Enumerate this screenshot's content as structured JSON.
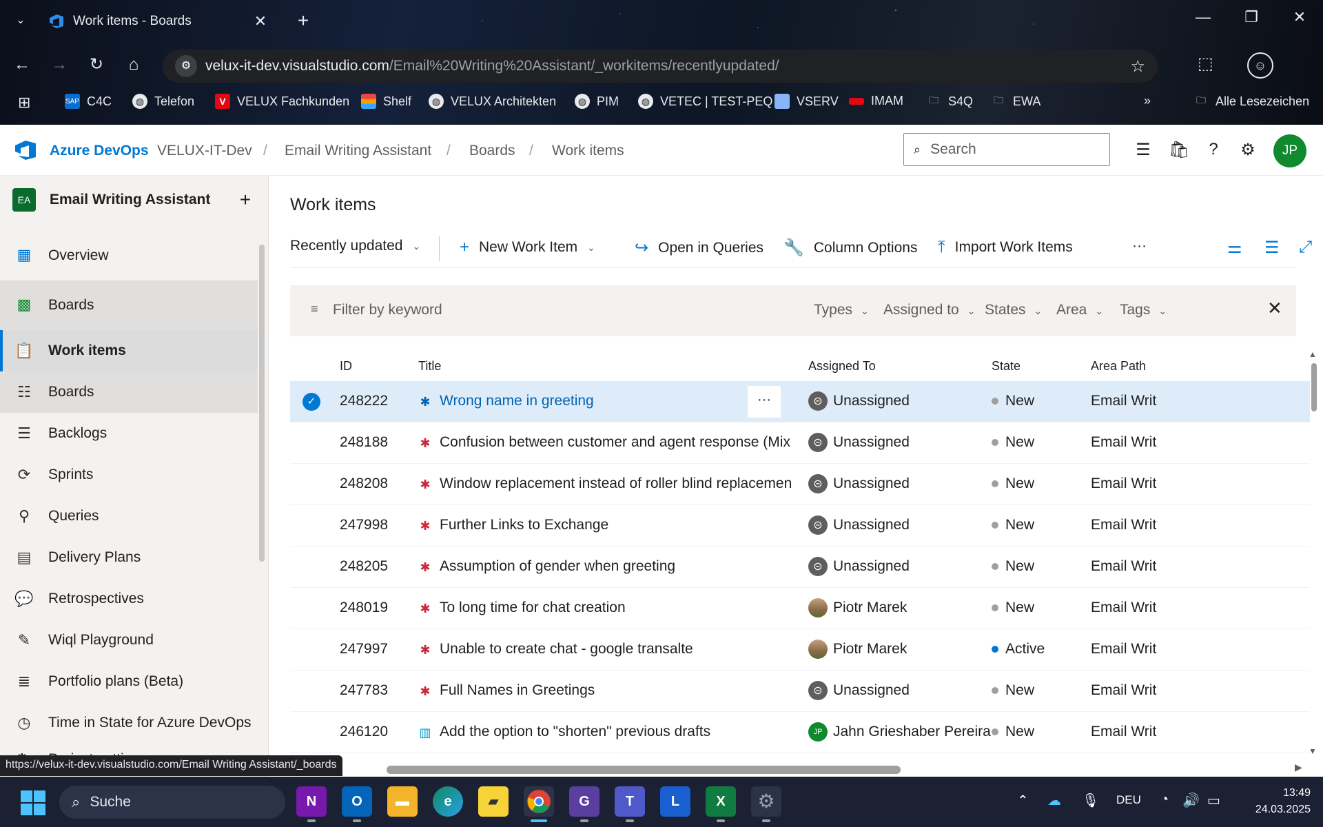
{
  "browser": {
    "tab_title": "Work items - Boards",
    "url_host": "velux-it-dev.visualstudio.com",
    "url_path": "/Email%20Writing%20Assistant/_workitems/recentlyupdated/",
    "bookmarks": [
      "C4C",
      "Telefon",
      "VELUX Fachkunden",
      "Shelf",
      "VELUX Architekten",
      "PIM",
      "VETEC | TEST-PEQ",
      "VSERV",
      "IMAM",
      "S4Q",
      "EWA"
    ],
    "all_bookmarks": "Alle Lesezeichen",
    "status_url": "https://velux-it-dev.visualstudio.com/Email Writing Assistant/_boards"
  },
  "header": {
    "brand": "Azure DevOps",
    "crumbs": [
      "VELUX-IT-Dev",
      "Email Writing Assistant",
      "Boards",
      "Work items"
    ],
    "search_placeholder": "Search",
    "avatar": "JP"
  },
  "sidebar": {
    "project_badge": "EA",
    "project_name": "Email Writing Assistant",
    "items": [
      {
        "label": "Overview"
      },
      {
        "label": "Boards"
      },
      {
        "label": "Work items"
      },
      {
        "label": "Boards"
      },
      {
        "label": "Backlogs"
      },
      {
        "label": "Sprints"
      },
      {
        "label": "Queries"
      },
      {
        "label": "Delivery Plans"
      },
      {
        "label": "Retrospectives"
      },
      {
        "label": "Wiql Playground"
      },
      {
        "label": "Portfolio plans (Beta)"
      },
      {
        "label": "Time in State for Azure DevOps"
      }
    ],
    "project_settings": "Project settings"
  },
  "main": {
    "title": "Work items",
    "view": "Recently updated",
    "commands": {
      "new_work_item": "New Work Item",
      "open_in_queries": "Open in Queries",
      "column_options": "Column Options",
      "import_work_items": "Import Work Items",
      "more": "···"
    },
    "filter": {
      "placeholder": "Filter by keyword",
      "types": "Types",
      "assigned_to": "Assigned to",
      "states": "States",
      "area": "Area",
      "tags": "Tags"
    },
    "columns": {
      "id": "ID",
      "title": "Title",
      "assigned_to": "Assigned To",
      "state": "State",
      "area_path": "Area Path"
    },
    "rows": [
      {
        "id": "248222",
        "title": "Wrong name in greeting",
        "type": "bug",
        "assigned": "Unassigned",
        "state": "New",
        "area": "Email Writ"
      },
      {
        "id": "248188",
        "title": "Confusion between customer and agent response (Mixing up the Con",
        "type": "bug",
        "assigned": "Unassigned",
        "state": "New",
        "area": "Email Writ"
      },
      {
        "id": "248208",
        "title": "Window replacement instead of roller blind replacement (Mixing up tl",
        "type": "bug",
        "assigned": "Unassigned",
        "state": "New",
        "area": "Email Writ"
      },
      {
        "id": "247998",
        "title": "Further Links to Exchange",
        "type": "bug",
        "assigned": "Unassigned",
        "state": "New",
        "area": "Email Writ"
      },
      {
        "id": "248205",
        "title": "Assumption of gender when greeting",
        "type": "bug",
        "assigned": "Unassigned",
        "state": "New",
        "area": "Email Writ"
      },
      {
        "id": "248019",
        "title": "To long time for chat creation",
        "type": "bug",
        "assigned": "Piotr Marek",
        "state": "New",
        "area": "Email Writ"
      },
      {
        "id": "247997",
        "title": "Unable to create chat - google transalte",
        "type": "bug",
        "assigned": "Piotr Marek",
        "state": "Active",
        "area": "Email Writ"
      },
      {
        "id": "247783",
        "title": "Full Names in Greetings",
        "type": "bug",
        "assigned": "Unassigned",
        "state": "New",
        "area": "Email Writ"
      },
      {
        "id": "246120",
        "title": "Add the option to \"shorten\" previous drafts",
        "type": "story",
        "assigned": "Jahn Grieshaber Pereira",
        "assigned_initials": "JP",
        "state": "New",
        "area": "Email Writ"
      }
    ]
  },
  "taskbar": {
    "search": "Suche",
    "language": "DEU",
    "time": "13:49",
    "date": "24.03.2025"
  },
  "colors": {
    "accent": "#0078d4",
    "state_new": "#a19f9d",
    "state_active": "#0078d4",
    "bug": "#cc293d",
    "story": "#009ccc"
  }
}
